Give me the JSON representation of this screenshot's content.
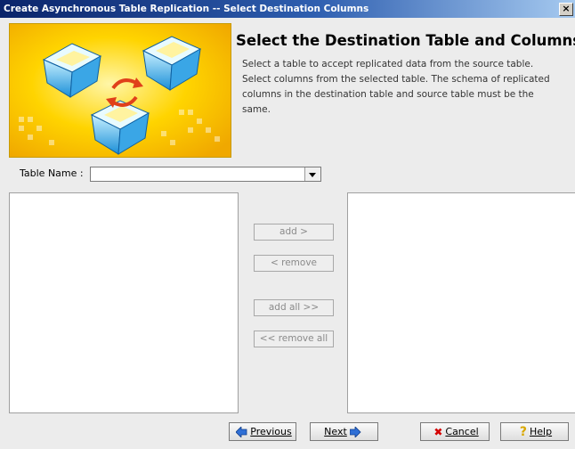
{
  "window": {
    "title": "Create Asynchronous Table Replication -- Select Destination Columns",
    "close_glyph": "×"
  },
  "header": {
    "title": "Select the Destination Table and Columns",
    "description": "Select a table to accept replicated data from the source table. Select columns from the selected table. The schema of replicated columns in the destination table and source table must be the same.",
    "banner_icon": "replication-illustration"
  },
  "table_name": {
    "label": "Table Name :",
    "value": ""
  },
  "transfer": {
    "add": "add >",
    "remove": "< remove",
    "add_all": "add all >>",
    "remove_all": "<< remove all"
  },
  "footer": {
    "previous": "Previous",
    "next": "Next",
    "cancel": "Cancel",
    "help": "Help"
  },
  "colors": {
    "titlebar": "#0a246a",
    "banner": "#f6c400",
    "disabled_text": "#8a8a8a"
  }
}
